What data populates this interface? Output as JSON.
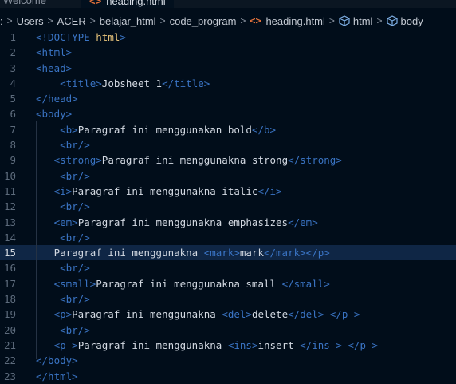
{
  "tabs": [
    {
      "label": "Welcome",
      "active": false
    },
    {
      "label": "heading.html",
      "active": true,
      "icon": "html-file-icon"
    }
  ],
  "breadcrumb": {
    "items": [
      ":",
      "Users",
      "ACER",
      "belajar_html",
      "code_program"
    ],
    "file": "heading.html",
    "symbols": [
      "html",
      "body"
    ]
  },
  "editor": {
    "current_line": 15,
    "lines": [
      {
        "n": "1",
        "code": "<!DOCTYPE html>"
      },
      {
        "n": "2",
        "code": "<html>"
      },
      {
        "n": "3",
        "code": "<head>"
      },
      {
        "n": "4",
        "code": "    <title>Jobsheet 1</title>"
      },
      {
        "n": "5",
        "code": "</head>"
      },
      {
        "n": "6",
        "code": "<body>"
      },
      {
        "n": "7",
        "code": "    <b>Paragraf ini menggunakan bold</b>"
      },
      {
        "n": "8",
        "code": "    <br/>"
      },
      {
        "n": "9",
        "code": "   <strong>Paragraf ini menggunakna strong</strong>"
      },
      {
        "n": "10",
        "code": "    <br/>"
      },
      {
        "n": "11",
        "code": "   <i>Paragraf ini menggunakna italic</i>"
      },
      {
        "n": "12",
        "code": "    <br/>"
      },
      {
        "n": "13",
        "code": "   <em>Paragraf ini menggunakna emphasizes</em>"
      },
      {
        "n": "14",
        "code": "    <br/>"
      },
      {
        "n": "15",
        "code": "   Paragraf ini menggunakna <mark>mark</mark></p>"
      },
      {
        "n": "16",
        "code": "    <br/>"
      },
      {
        "n": "17",
        "code": "   <small>Paragraf ini menggunakna small </small>"
      },
      {
        "n": "18",
        "code": "    <br/>"
      },
      {
        "n": "19",
        "code": "   <p>Paragraf ini menggunakna <del>delete</del> </p >"
      },
      {
        "n": "20",
        "code": "    <br/>"
      },
      {
        "n": "21",
        "code": "   <p >Paragraf ini menggunakna <ins>insert </ins > </p >"
      },
      {
        "n": "22",
        "code": "</body>"
      },
      {
        "n": "23",
        "code": "</html>"
      }
    ]
  }
}
